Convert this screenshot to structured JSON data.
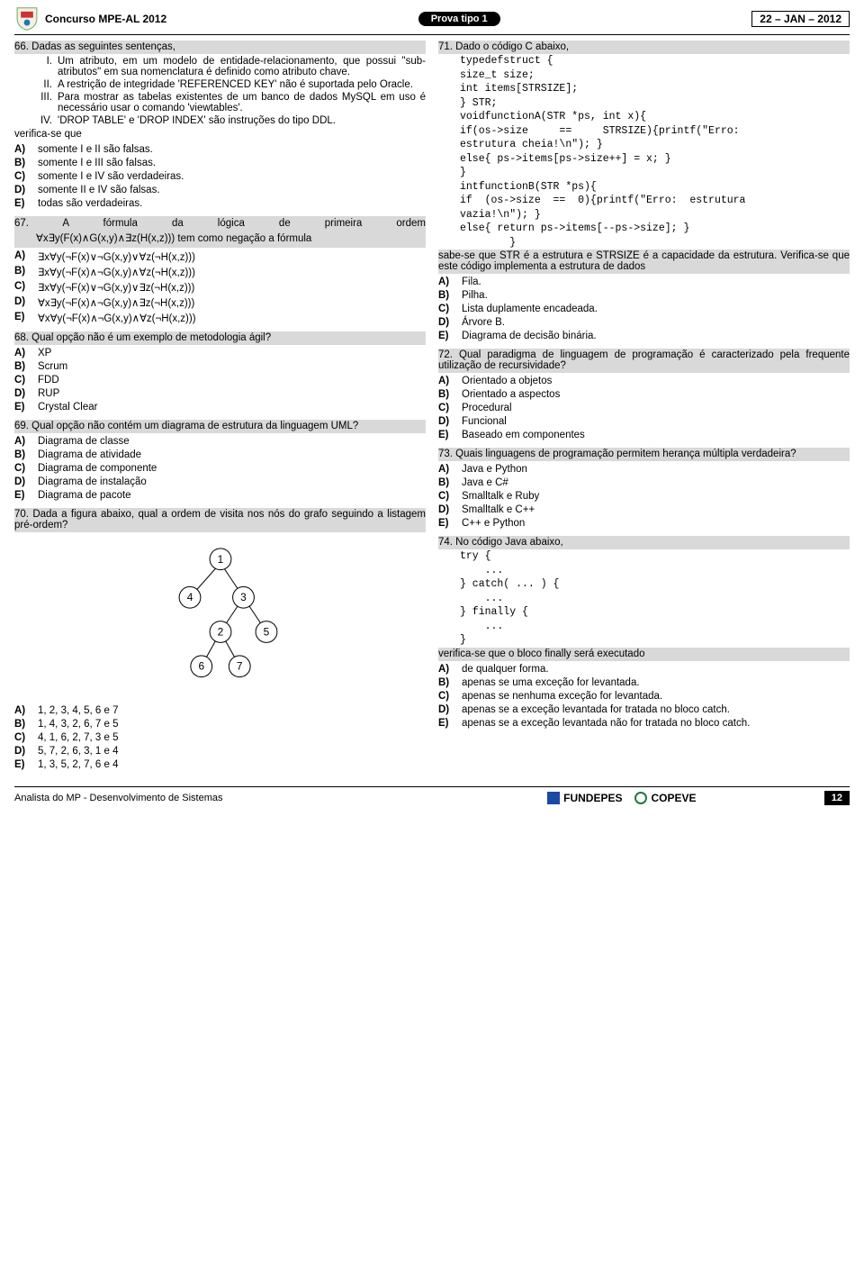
{
  "header": {
    "left": "Concurso MPE-AL 2012",
    "pill": "Prova tipo 1",
    "right": "22 – JAN – 2012"
  },
  "q66": {
    "lead": "66. Dadas as seguintes sentenças,",
    "romans": {
      "i_k": "I.",
      "i": "Um atributo, em um modelo de entidade-relacionamento, que possui \"sub-atributos\" em sua nomenclatura é definido como atributo chave.",
      "ii_k": "II.",
      "ii": "A restrição de integridade 'REFERENCED KEY' não é suportada pelo Oracle.",
      "iii_k": "III.",
      "iii": "Para mostrar as tabelas existentes de um banco de dados MySQL em uso é necessário usar o comando 'viewtables'.",
      "iv_k": "IV.",
      "iv": "'DROP TABLE' e 'DROP INDEX' são instruções do tipo DDL."
    },
    "verify": "verifica-se que",
    "opts": {
      "a": "somente I e II são falsas.",
      "b": "somente I e III são falsas.",
      "c": "somente I e IV são verdadeiras.",
      "d": "somente II e IV são falsas.",
      "e": "todas são verdadeiras."
    }
  },
  "q67": {
    "lead1": "67. A   fórmula   da   lógica   de   primeira   ordem",
    "lead2": "∀x∃y(F(x)∧G(x,y)∧∃z(H(x,z))) tem como negação a fórmula",
    "opts": {
      "a": "∃x∀y(¬F(x)∨¬G(x,y)∨∀z(¬H(x,z)))",
      "b": "∃x∀y(¬F(x)∧¬G(x,y)∧∀z(¬H(x,z)))",
      "c": "∃x∀y(¬F(x)∨¬G(x,y)∨∃z(¬H(x,z)))",
      "d": "∀x∃y(¬F(x)∧¬G(x,y)∧∃z(¬H(x,z)))",
      "e": "∀x∀y(¬F(x)∧¬G(x,y)∧∀z(¬H(x,z)))"
    }
  },
  "q68": {
    "lead": "68. Qual opção não é um exemplo de metodologia ágil?",
    "opts": {
      "a": "XP",
      "b": "Scrum",
      "c": "FDD",
      "d": "RUP",
      "e": "Crystal Clear"
    }
  },
  "q69": {
    "lead": "69. Qual opção não contém um diagrama de estrutura da linguagem UML?",
    "opts": {
      "a": "Diagrama de classe",
      "b": "Diagrama de atividade",
      "c": "Diagrama de componente",
      "d": "Diagrama de instalação",
      "e": "Diagrama de pacote"
    }
  },
  "q70": {
    "lead": "70. Dada a figura abaixo, qual a ordem de visita nos nós do grafo seguindo a listagem pré-ordem?",
    "nodes": {
      "n1": "1",
      "n2": "2",
      "n3": "3",
      "n4": "4",
      "n5": "5",
      "n6": "6",
      "n7": "7"
    },
    "opts": {
      "a": "1, 2, 3, 4, 5, 6 e 7",
      "b": "1, 4, 3, 2, 6, 7 e 5",
      "c": "4, 1, 6, 2, 7, 3 e 5",
      "d": "5, 7, 2, 6, 3, 1 e 4",
      "e": "1, 3, 5, 2, 7, 6 e 4"
    }
  },
  "q71": {
    "lead": "71. Dado o código C abaixo,",
    "code": "typedefstruct {\nsize_t size;\nint items[STRSIZE];\n} STR;\nvoidfunctionA(STR *ps, int x){\nif(os->size     ==     STRSIZE){printf(\"Erro:\nestrutura cheia!\\n\"); }\nelse{ ps->items[ps->size++] = x; }\n}\nintfunctionB(STR *ps){\nif  (os->size  ==  0){printf(\"Erro:  estrutura\nvazia!\\n\"); }\nelse{ return ps->items[--ps->size]; }\n        }",
    "post": "sabe-se que STR é a estrutura e STRSIZE é a capacidade da estrutura. Verifica-se que este código implementa a estrutura de dados",
    "opts": {
      "a": "Fila.",
      "b": "Pilha.",
      "c": "Lista duplamente encadeada.",
      "d": "Árvore B.",
      "e": "Diagrama de decisão binária."
    }
  },
  "q72": {
    "lead": "72. Qual paradigma de linguagem de programação é caracterizado pela frequente utilização de recursividade?",
    "opts": {
      "a": "Orientado a objetos",
      "b": "Orientado a aspectos",
      "c": "Procedural",
      "d": "Funcional",
      "e": "Baseado em componentes"
    }
  },
  "q73": {
    "lead": "73. Quais linguagens de programação permitem herança múltipla verdadeira?",
    "opts": {
      "a": "Java e Python",
      "b": "Java e C#",
      "c": "Smalltalk e Ruby",
      "d": "Smalltalk e C++",
      "e": "C++ e Python"
    }
  },
  "q74": {
    "lead": "74. No código Java abaixo,",
    "code": "try {\n    ...\n} catch( ... ) {\n    ...\n} finally {\n    ...\n}",
    "post": "verifica-se que o bloco finally será executado",
    "opts": {
      "a": "de qualquer forma.",
      "b": "apenas se uma exceção for levantada.",
      "c": "apenas se nenhuma exceção for levantada.",
      "d": "apenas se a exceção levantada for tratada no bloco catch.",
      "e": "apenas se a exceção levantada não for tratada no bloco catch."
    }
  },
  "optkeys": {
    "a": "A)",
    "b": "B)",
    "c": "C)",
    "d": "D)",
    "e": "E)"
  },
  "footer": {
    "left": "Analista do MP - Desenvolvimento de Sistemas",
    "fundepes": "FUNDEPES",
    "copeve": "COPEVE",
    "page": "12"
  }
}
